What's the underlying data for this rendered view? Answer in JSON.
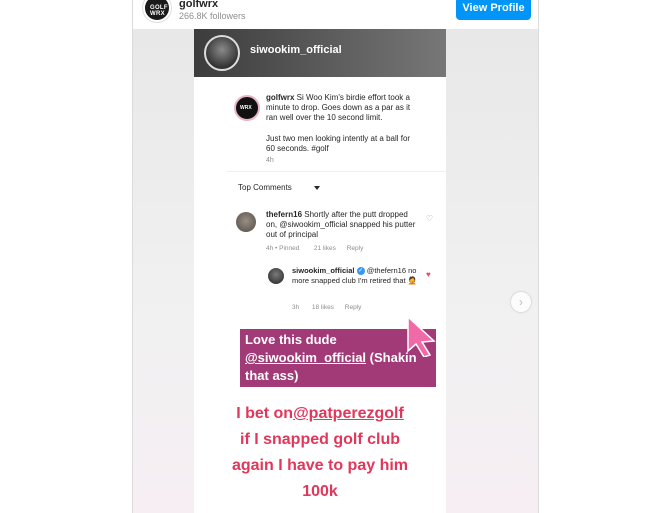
{
  "header": {
    "username": "golfwrx",
    "followers": "266.8K followers",
    "view_profile_label": "View Profile",
    "avatar_text": "GOLF WRX"
  },
  "story": {
    "username": "siwookim_official"
  },
  "post": {
    "logo_text": "WRX",
    "author": "golfwrx",
    "caption_1": " Si Woo Kim's birdie effort took a minute to drop. Goes down as a par as it ran well over the 10 second limit.",
    "caption_2": "Just two men looking intently at a ball for 60 seconds. #golf",
    "time": "4h",
    "top_comments_label": "Top Comments",
    "comment_1": {
      "user": "thefern16",
      "text": " Shortly after the putt dropped on, @siwookim_official snapped his putter out of principal",
      "time": "4h",
      "pinned": "• Pinned",
      "likes": "21 likes",
      "reply": "Reply"
    },
    "comment_2": {
      "user": "siwookim_official",
      "mention": " @thefern16",
      "text": " no more snapped club I'm retired that 🤦",
      "time": "3h",
      "likes": "18 likes",
      "reply": "Reply"
    }
  },
  "sticker": {
    "line_1": "Love this dude",
    "mention": "@siwookim_official",
    "rest": " (Shakin that ass)"
  },
  "overlay": {
    "line_1_prefix": "I bet on",
    "line_1_mention": "@patperezgolf",
    "line_2": "if I snapped golf club",
    "line_3": "again I have to pay him",
    "line_4": "100k"
  },
  "colors": {
    "accent_button": "#0095f6",
    "overlay_text": "#e0375a",
    "sticker_bg": "#a23a78"
  },
  "icons": {
    "next": "chevron-right-icon"
  }
}
